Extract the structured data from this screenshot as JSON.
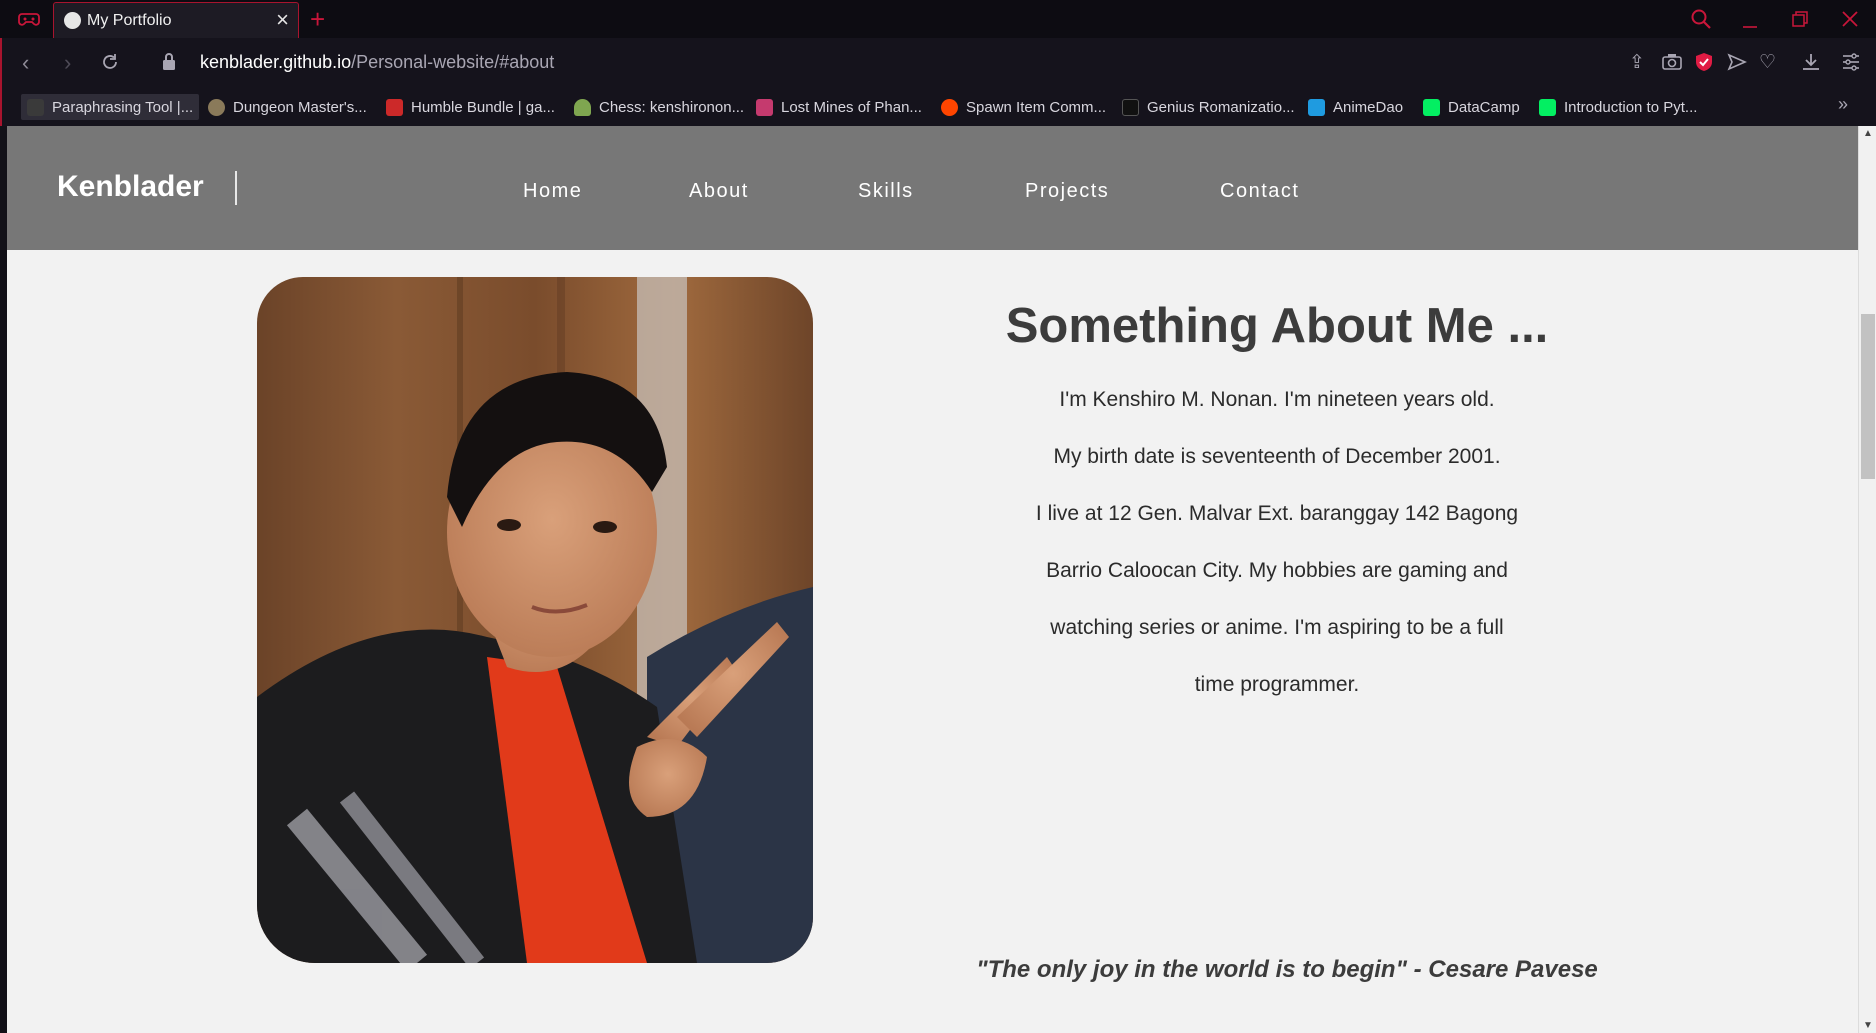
{
  "browser": {
    "tab_title": "My Portfolio",
    "url_domain": "kenblader.github.io",
    "url_path": "/Personal-website/#about",
    "accent": "#c9163a"
  },
  "bookmarks": [
    {
      "label": "Paraphrasing Tool |...",
      "icon": "feather-icon",
      "color": "#3a3a3a"
    },
    {
      "label": "Dungeon Master's...",
      "icon": "dnd-icon",
      "color": "#8a7a5a"
    },
    {
      "label": "Humble Bundle | ga...",
      "icon": "humble-icon",
      "color": "#cc2929"
    },
    {
      "label": "Chess: kenshironon...",
      "icon": "chess-pawn-icon",
      "color": "#7fa650"
    },
    {
      "label": "Lost Mines of Phan...",
      "icon": "dnd-beyond-icon",
      "color": "#c53a6e"
    },
    {
      "label": "Spawn Item Comm...",
      "icon": "reddit-icon",
      "color": "#ff4500"
    },
    {
      "label": "Genius Romanizatio...",
      "icon": "genius-icon",
      "color": "#111111"
    },
    {
      "label": "AnimeDao",
      "icon": "animedao-icon",
      "color": "#1f9be0"
    },
    {
      "label": "DataCamp",
      "icon": "datacamp-icon",
      "color": "#03ef62"
    },
    {
      "label": "Introduction to Pyt...",
      "icon": "datacamp-icon",
      "color": "#03ef62"
    }
  ],
  "site": {
    "brand": "Kenblader",
    "nav": [
      "Home",
      "About",
      "Skills",
      "Projects",
      "Contact"
    ]
  },
  "about": {
    "title": "Something About Me ...",
    "bio_lines": [
      "I'm Kenshiro M. Nonan. I'm nineteen years old.",
      "My birth date is seventeenth of December 2001.",
      "I live at 12 Gen. Malvar Ext. baranggay 142 Bagong",
      "Barrio Caloocan City. My hobbies are gaming and",
      "watching series or anime. I'm aspiring to be a full",
      "time programmer."
    ],
    "quote": "\"The only joy in the world is to begin\" - Cesare Pavese"
  }
}
